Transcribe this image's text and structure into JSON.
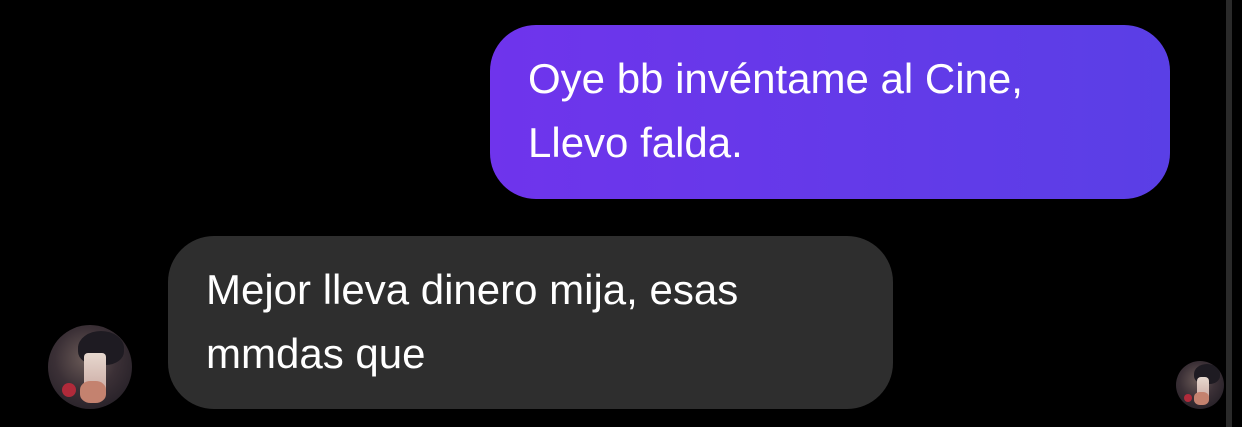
{
  "conversation": {
    "messages": [
      {
        "direction": "sent",
        "lines": [
          "Oye bb invéntame al Cine,",
          "Llevo falda."
        ]
      },
      {
        "direction": "received",
        "lines": [
          "Mejor lleva dinero mija, esas",
          "mmdas que"
        ]
      }
    ]
  },
  "colors": {
    "background": "#000000",
    "sent_bubble_start": "#6f34ec",
    "sent_bubble_end": "#5a3fe6",
    "received_bubble": "#2e2e2e",
    "text": "#ffffff"
  },
  "icons": {
    "contact_avatar": "contact-avatar-photo",
    "seen_avatar": "seen-receipt-avatar"
  }
}
